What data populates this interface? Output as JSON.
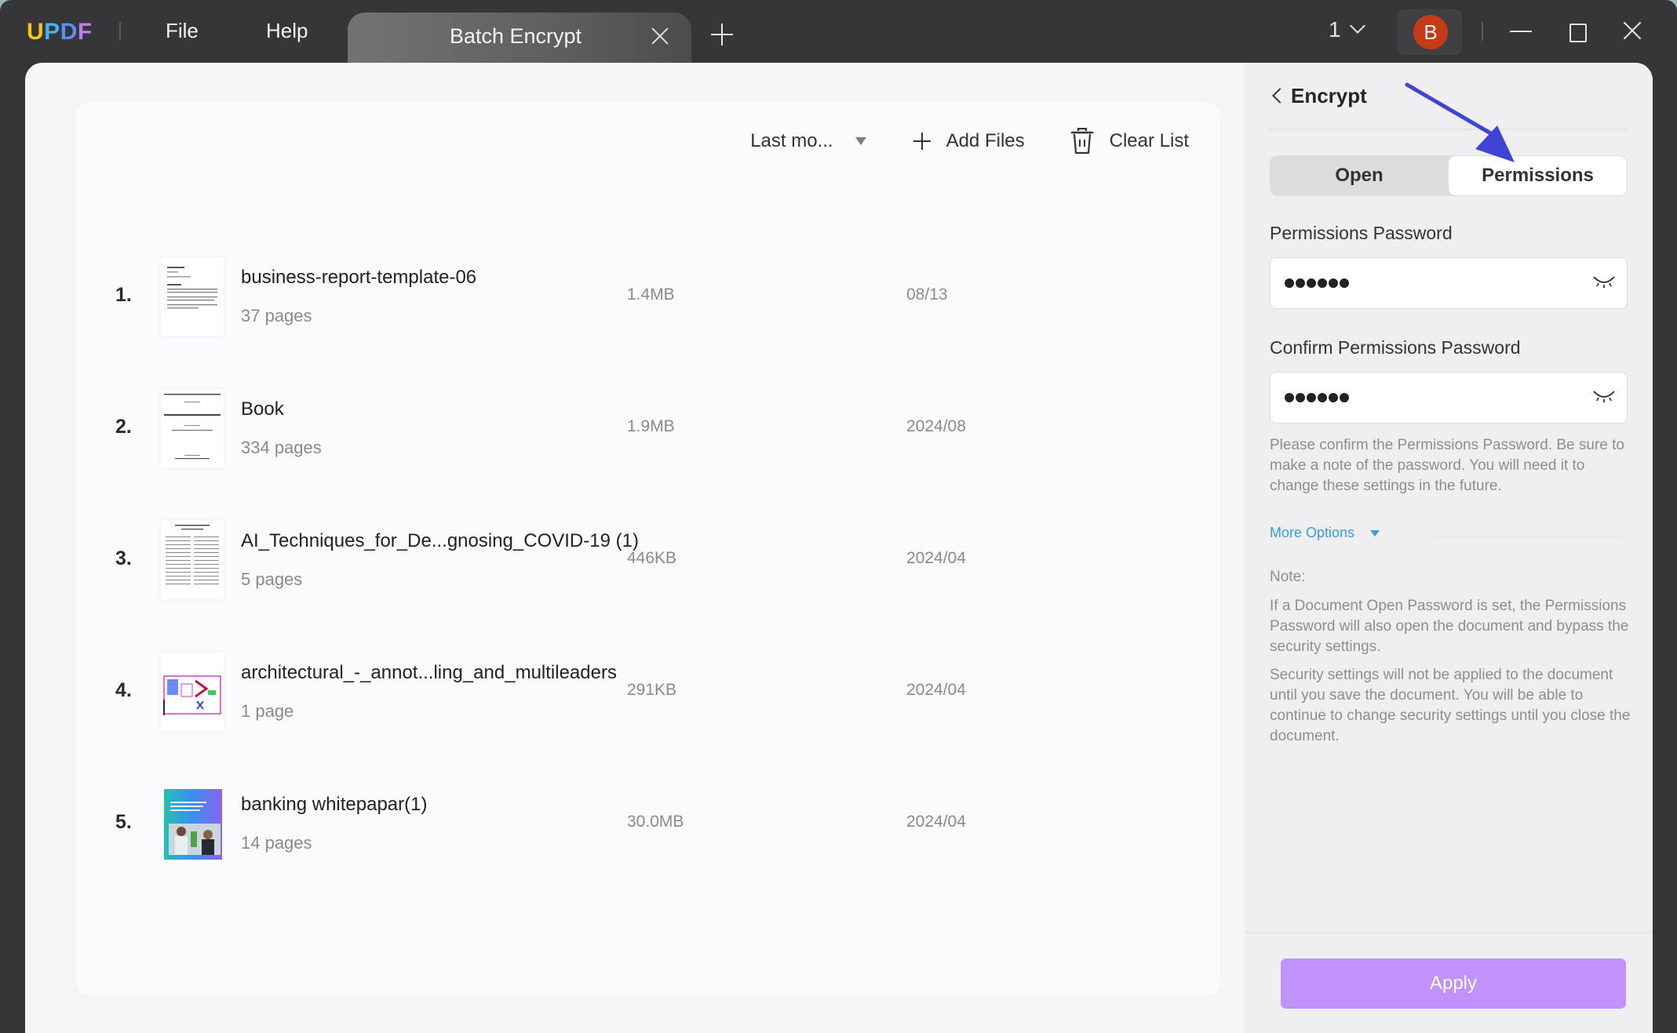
{
  "app": {
    "logo": [
      "U",
      "P",
      "D",
      "F"
    ],
    "logo_colors": [
      "#f5c518",
      "#47b0ef",
      "#5b8df5",
      "#c17cf2"
    ],
    "menu": [
      "File",
      "Help"
    ],
    "tab_title": "Batch Encrypt",
    "window_count": "1",
    "avatar_initial": "B",
    "avatar_color": "#c73a16"
  },
  "toolbar": {
    "sort_label": "Last mo...",
    "add_files": "Add Files",
    "clear_list": "Clear List"
  },
  "files": [
    {
      "index": "1.",
      "name": "business-report-template-06",
      "pages": "37 pages",
      "size": "1.4MB",
      "date": "08/13",
      "thumb": "text-doc"
    },
    {
      "index": "2.",
      "name": "Book",
      "pages": "334 pages",
      "size": "1.9MB",
      "date": "2024/08",
      "thumb": "title-page"
    },
    {
      "index": "3.",
      "name": "AI_Techniques_for_De...gnosing_COVID-19 (1)",
      "pages": "5 pages",
      "size": "446KB",
      "date": "2024/04",
      "thumb": "paper-columns"
    },
    {
      "index": "4.",
      "name": "architectural_-_annot...ling_and_multileaders",
      "pages": "1 page",
      "size": "291KB",
      "date": "2024/04",
      "thumb": "cad-drawing"
    },
    {
      "index": "5.",
      "name": "banking whitepapar(1)",
      "pages": "14 pages",
      "size": "30.0MB",
      "date": "2024/04",
      "thumb": "gradient-cover"
    }
  ],
  "panel": {
    "title": "Encrypt",
    "tabs": [
      "Open",
      "Permissions"
    ],
    "active_tab": "Permissions",
    "password_label": "Permissions Password",
    "password_value_length": 6,
    "confirm_label": "Confirm Permissions Password",
    "confirm_value_length": 6,
    "hint": "Please confirm the Permissions Password. Be sure to make a note of the password. You will need it to change these settings in the future.",
    "more_options": "More Options",
    "note_label": "Note:",
    "note_1": "If a Document Open Password is set, the Permissions Password will also open the document and bypass the security settings.",
    "note_2": "Security settings will not be applied to the document until you save the document. You will be able to continue to change security settings until you close the document.",
    "apply_label": "Apply",
    "apply_color": "#c191fc",
    "link_color": "#3a9be0"
  },
  "annotation": {
    "type": "arrow",
    "color": "#3d44d6",
    "points_to": "Permissions tab"
  }
}
